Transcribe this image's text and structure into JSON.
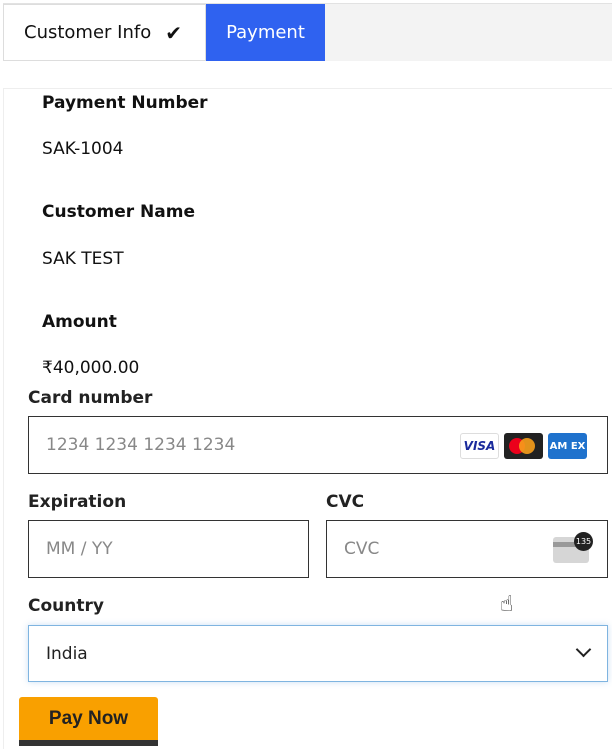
{
  "tabs": [
    {
      "label": "Customer Info",
      "check": "✔"
    },
    {
      "label": "Payment"
    }
  ],
  "details": [
    {
      "label": "Payment Number",
      "value": "SAK-1004"
    },
    {
      "label": "Customer Name",
      "value": "SAK TEST"
    },
    {
      "label": "Amount",
      "value": "₹40,000.00"
    }
  ],
  "form": {
    "card_label": "Card number",
    "card_placeholder": "1234 1234 1234 1234",
    "brands": {
      "visa": "VISA",
      "amex": "AM EX"
    },
    "exp_label": "Expiration",
    "exp_placeholder": "MM / YY",
    "cvc_label": "CVC",
    "cvc_placeholder": "CVC",
    "cvc_badge": "135",
    "country_label": "Country",
    "country_value": "India",
    "pay_label": "Pay Now"
  },
  "colors": {
    "tab_active": "#2f62f0",
    "pay": "#f9a000"
  }
}
